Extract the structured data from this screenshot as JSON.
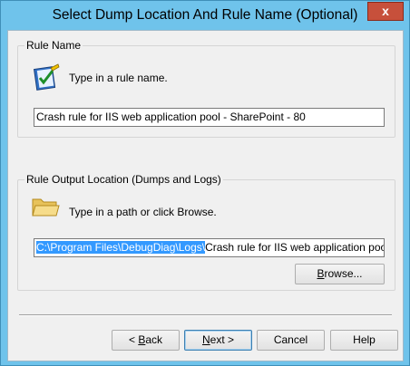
{
  "window": {
    "title": "Select Dump Location And Rule Name (Optional)",
    "close_glyph": "x"
  },
  "rule_name": {
    "group_label": "Rule Name",
    "prompt": "Type in a rule name.",
    "value": "Crash rule for IIS web application pool - SharePoint - 80",
    "icon": "notepad-check-icon"
  },
  "output": {
    "group_label": "Rule Output Location (Dumps and Logs)",
    "prompt": "Type in a path or click Browse.",
    "path_selected": "C:\\Program Files\\DebugDiag\\Logs\\",
    "path_rest": "Crash rule for IIS web application pool - Share",
    "icon": "folder-icon",
    "browse_prefix": "",
    "browse_ul": "B",
    "browse_rest": "rowse..."
  },
  "buttons": {
    "back_pre": "< ",
    "back_ul": "B",
    "back_rest": "ack",
    "next_ul": "N",
    "next_rest": "ext >",
    "cancel": "Cancel",
    "help": "Help"
  },
  "colors": {
    "frame": "#6fc3eb",
    "close": "#c7503b",
    "selection": "#3399ff"
  }
}
